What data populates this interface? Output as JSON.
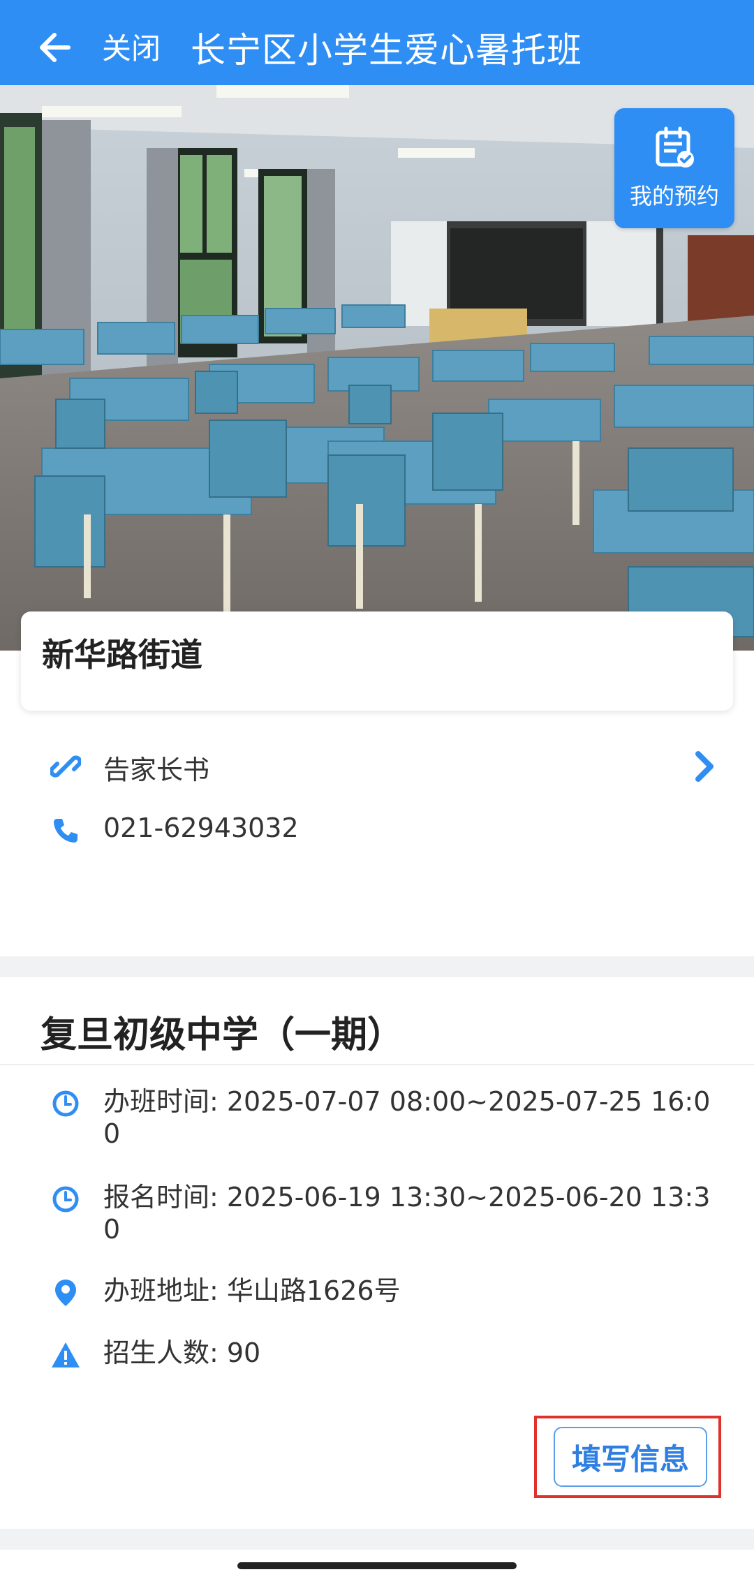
{
  "header": {
    "close_label": "关闭",
    "title": "长宁区小学生爱心暑托班"
  },
  "hero": {
    "my_booking_label": "我的预约"
  },
  "street": {
    "name": "新华路街道",
    "links": [
      {
        "icon": "link-icon",
        "label": "告家长书"
      },
      {
        "icon": "phone-icon",
        "label": "021-62943032"
      }
    ]
  },
  "school": {
    "title": "复旦初级中学（一期）",
    "details": [
      {
        "icon": "clock-icon",
        "text": "办班时间: 2025-07-07 08:00~2025-07-25 16:00"
      },
      {
        "icon": "clock-icon",
        "text": "报名时间: 2025-06-19 13:30~2025-06-20 13:30"
      },
      {
        "icon": "location-pin-icon",
        "text": "办班地址: 华山路1626号"
      },
      {
        "icon": "warning-icon",
        "text": "招生人数: 90"
      }
    ],
    "fill_button_label": "填写信息"
  },
  "colors": {
    "primary": "#2f8ef4",
    "highlight_border": "#e0312b"
  }
}
